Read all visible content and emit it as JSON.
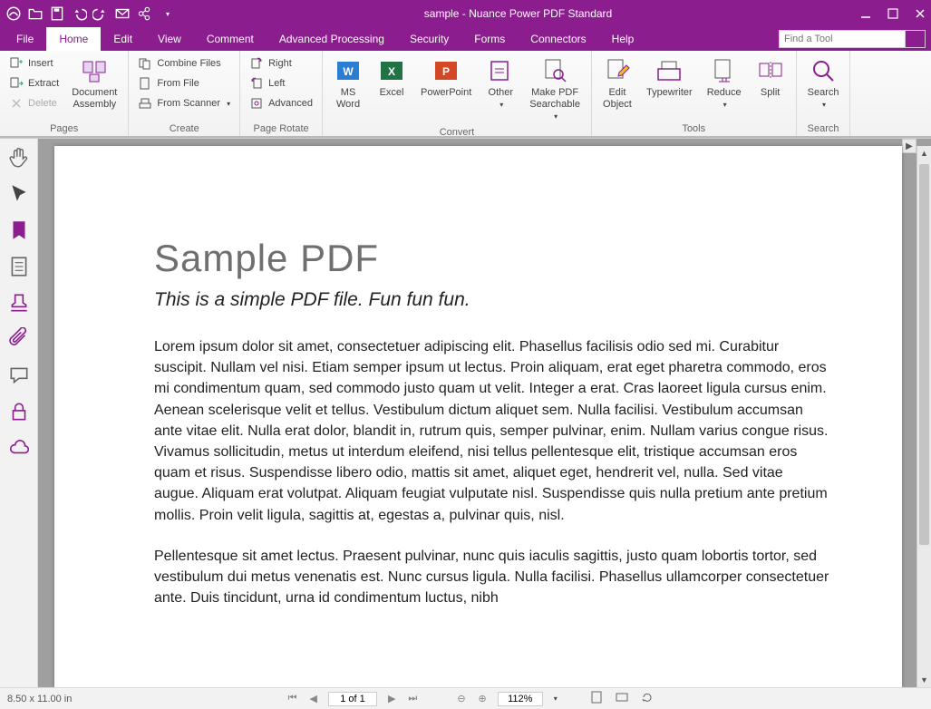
{
  "title": "sample - Nuance Power PDF Standard",
  "menu": {
    "file": "File",
    "home": "Home",
    "edit": "Edit",
    "view": "View",
    "comment": "Comment",
    "advanced": "Advanced Processing",
    "security": "Security",
    "forms": "Forms",
    "connectors": "Connectors",
    "help": "Help"
  },
  "find_placeholder": "Find a Tool",
  "ribbon": {
    "pages": {
      "insert": "Insert",
      "extract": "Extract",
      "delete": "Delete",
      "assembly": "Document\nAssembly",
      "label": "Pages"
    },
    "create": {
      "combine": "Combine Files",
      "fromfile": "From File",
      "scanner": "From Scanner",
      "label": "Create"
    },
    "rotate": {
      "right": "Right",
      "left": "Left",
      "advanced": "Advanced",
      "label": "Page Rotate"
    },
    "convert": {
      "word": "MS\nWord",
      "excel": "Excel",
      "ppt": "PowerPoint",
      "other": "Other",
      "searchable": "Make PDF\nSearchable",
      "label": "Convert"
    },
    "tools": {
      "editobj": "Edit\nObject",
      "typewriter": "Typewriter",
      "reduce": "Reduce",
      "split": "Split",
      "label": "Tools"
    },
    "search": {
      "search": "Search",
      "label": "Search"
    }
  },
  "doc": {
    "heading": "Sample PDF",
    "subtitle": "This is a simple PDF file. Fun fun fun.",
    "para1": "Lorem ipsum dolor sit amet, consectetuer adipiscing elit. Phasellus facilisis odio sed mi. Curabitur suscipit. Nullam vel nisi. Etiam semper ipsum ut lectus. Proin aliquam, erat eget pharetra commodo, eros mi condimentum quam, sed commodo justo quam ut velit. Integer a erat. Cras laoreet ligula cursus enim. Aenean scelerisque velit et tellus. Vestibulum dictum aliquet sem. Nulla facilisi. Vestibulum accumsan ante vitae elit. Nulla erat dolor, blandit in, rutrum quis, semper pulvinar, enim. Nullam varius congue risus. Vivamus sollicitudin, metus ut interdum eleifend, nisi tellus pellentesque elit, tristique accumsan eros quam et risus. Suspendisse libero odio, mattis sit amet, aliquet eget, hendrerit vel, nulla. Sed vitae augue. Aliquam erat volutpat. Aliquam feugiat vulputate nisl. Suspendisse quis nulla pretium ante pretium mollis. Proin velit ligula, sagittis at, egestas a, pulvinar quis, nisl.",
    "para2": "Pellentesque sit amet lectus. Praesent pulvinar, nunc quis iaculis sagittis, justo quam lobortis tortor, sed vestibulum dui metus venenatis est. Nunc cursus ligula. Nulla facilisi. Phasellus ullamcorper consectetuer ante. Duis tincidunt, urna id condimentum luctus, nibh"
  },
  "status": {
    "size": "8.50 x 11.00 in",
    "page": "1 of 1",
    "zoom": "112%"
  }
}
